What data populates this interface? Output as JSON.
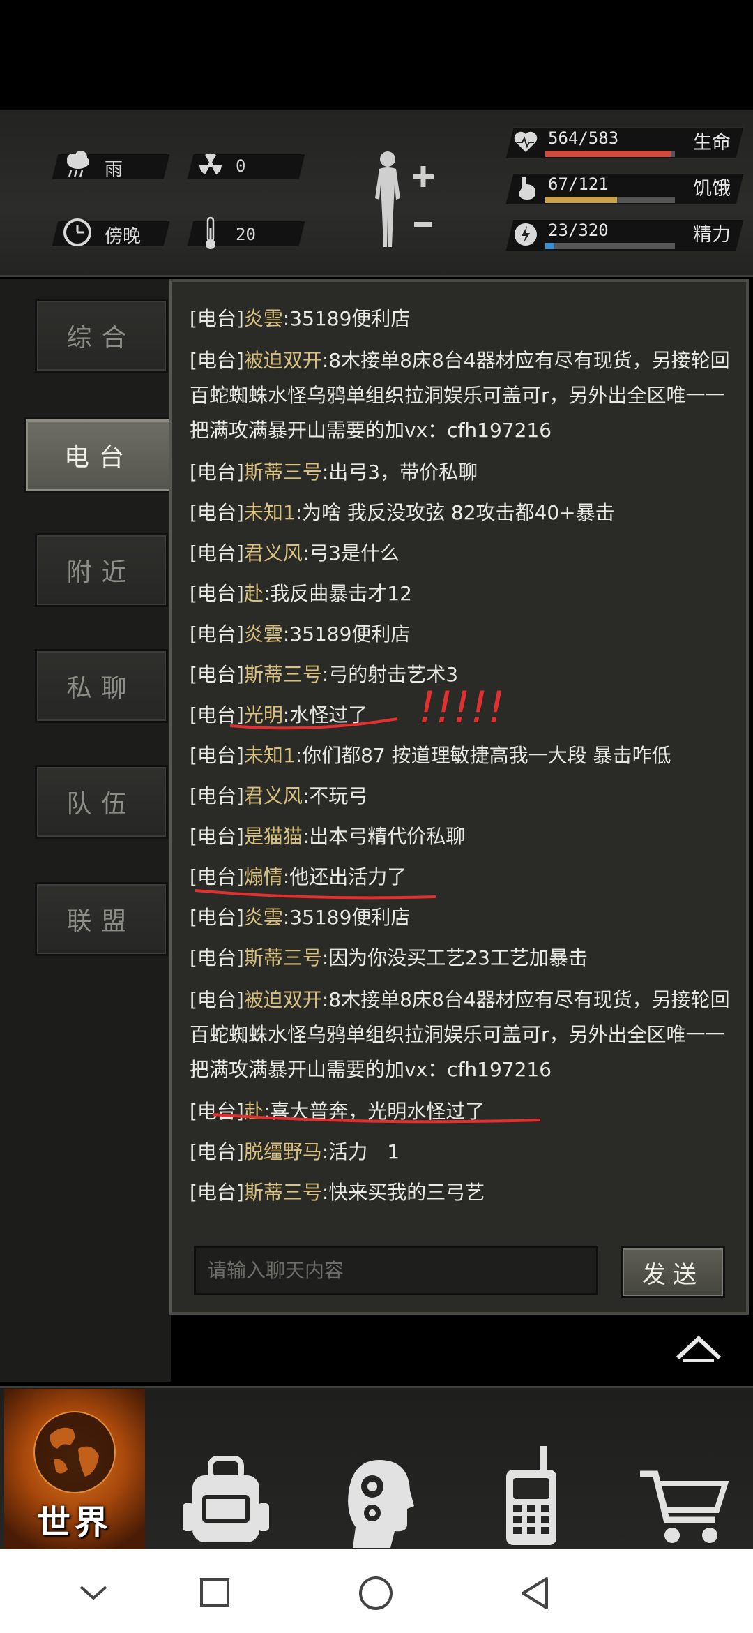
{
  "status": {
    "weather": "雨",
    "radiation": "0",
    "time_of_day": "傍晚",
    "temperature": "20",
    "bars": [
      {
        "label": "564/583",
        "name": "生命",
        "fraction": 0.967,
        "color": "#d24a3a",
        "icon": "heart-icon"
      },
      {
        "label": "67/121",
        "name": "饥饿",
        "fraction": 0.554,
        "color": "#c9a24a",
        "icon": "stomach-icon"
      },
      {
        "label": "23/320",
        "name": "精力",
        "fraction": 0.072,
        "color": "#3a8fd4",
        "icon": "energy-icon"
      }
    ]
  },
  "tabs": [
    {
      "label": "综合",
      "active": false
    },
    {
      "label": "电台",
      "active": true
    },
    {
      "label": "附近",
      "active": false
    },
    {
      "label": "私聊",
      "active": false
    },
    {
      "label": "队伍",
      "active": false
    },
    {
      "label": "联盟",
      "active": false
    }
  ],
  "messages": [
    {
      "channel": "[电台]",
      "user": "炎雲",
      "text": ":35189便利店"
    },
    {
      "channel": "[电台]",
      "user": "被迫双开",
      "text": ":8木接单8床8台4器材应有尽有现货，另接轮回百蛇蜘蛛水怪乌鸦单组织拉洞娱乐可盖可r，另外出全区唯一一把满攻满暴开山需要的加vx：cfh197216"
    },
    {
      "channel": "[电台]",
      "user": "斯蒂三号",
      "text": ":出弓3，带价私聊"
    },
    {
      "channel": "[电台]",
      "user": "未知1",
      "text": ":为啥 我反没攻弦 82攻击都40+暴击"
    },
    {
      "channel": "[电台]",
      "user": "君义风",
      "text": ":弓3是什么"
    },
    {
      "channel": "[电台]",
      "user": "赴",
      "text": ":我反曲暴击才12"
    },
    {
      "channel": "[电台]",
      "user": "炎雲",
      "text": ":35189便利店"
    },
    {
      "channel": "[电台]",
      "user": "斯蒂三号",
      "text": ":弓的射击艺术3"
    },
    {
      "channel": "[电台]",
      "user": "光明",
      "text": ":水怪过了"
    },
    {
      "channel": "[电台]",
      "user": "未知1",
      "text": ":你们都87 按道理敏捷高我一大段 暴击咋低"
    },
    {
      "channel": "[电台]",
      "user": "君义风",
      "text": ":不玩弓"
    },
    {
      "channel": "[电台]",
      "user": "是猫猫",
      "text": ":出本弓精代价私聊"
    },
    {
      "channel": "[电台]",
      "user": "煽情",
      "text": ":他还出活力了"
    },
    {
      "channel": "[电台]",
      "user": "炎雲",
      "text": ":35189便利店"
    },
    {
      "channel": "[电台]",
      "user": "斯蒂三号",
      "text": ":因为你没买工艺23工艺加暴击"
    },
    {
      "channel": "[电台]",
      "user": "被迫双开",
      "text": ":8木接单8床8台4器材应有尽有现货，另接轮回百蛇蜘蛛水怪乌鸦单组织拉洞娱乐可盖可r，另外出全区唯一一把满攻满暴开山需要的加vx：cfh197216"
    },
    {
      "channel": "[电台]",
      "user": "赴",
      "text": ":喜大普奔，光明水怪过了"
    },
    {
      "channel": "[电台]",
      "user": "脱缰野马",
      "text": ":活力　1"
    },
    {
      "channel": "[电台]",
      "user": "斯蒂三号",
      "text": ":快来买我的三弓艺"
    }
  ],
  "annotation": "!!!!!",
  "input": {
    "placeholder": "请输入聊天内容"
  },
  "send_label": "发送",
  "bottom_nav": [
    {
      "label": "世界",
      "icon": "globe-icon",
      "active": true
    },
    {
      "label": "",
      "icon": "backpack-icon",
      "active": false
    },
    {
      "label": "",
      "icon": "head-gears-icon",
      "active": false
    },
    {
      "label": "",
      "icon": "radio-icon",
      "active": false
    },
    {
      "label": "",
      "icon": "cart-icon",
      "active": false
    }
  ]
}
